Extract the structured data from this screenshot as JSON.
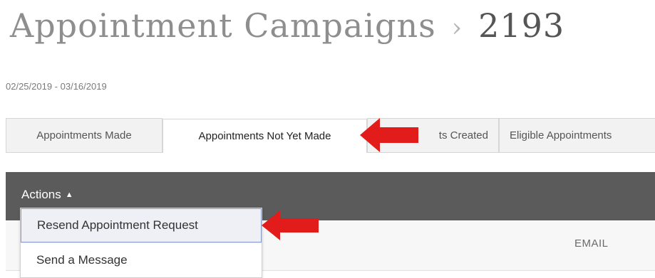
{
  "header": {
    "title": "Appointment Campaigns",
    "separator": "›",
    "campaign_id": "2193"
  },
  "date_range": "02/25/2019 - 03/16/2019",
  "tabs": [
    {
      "label": "Appointments Made",
      "active": false
    },
    {
      "label": "Appointments Not Yet Made",
      "active": true
    },
    {
      "label": "ts Created",
      "active": false
    },
    {
      "label": "Eligible Appointments",
      "active": false
    }
  ],
  "toolbar": {
    "actions_label": "Actions",
    "actions_icon": "caret-up-icon"
  },
  "actions_menu": {
    "items": [
      {
        "label": "Resend Appointment Request",
        "highlighted": true
      },
      {
        "label": "Send a Message",
        "highlighted": false
      }
    ]
  },
  "table": {
    "columns": [
      "EMAIL"
    ]
  },
  "colors": {
    "toolbar_bg": "#5b5b5b",
    "annotation_arrow": "#e21b1b",
    "highlight_border": "#8fa0c8"
  }
}
